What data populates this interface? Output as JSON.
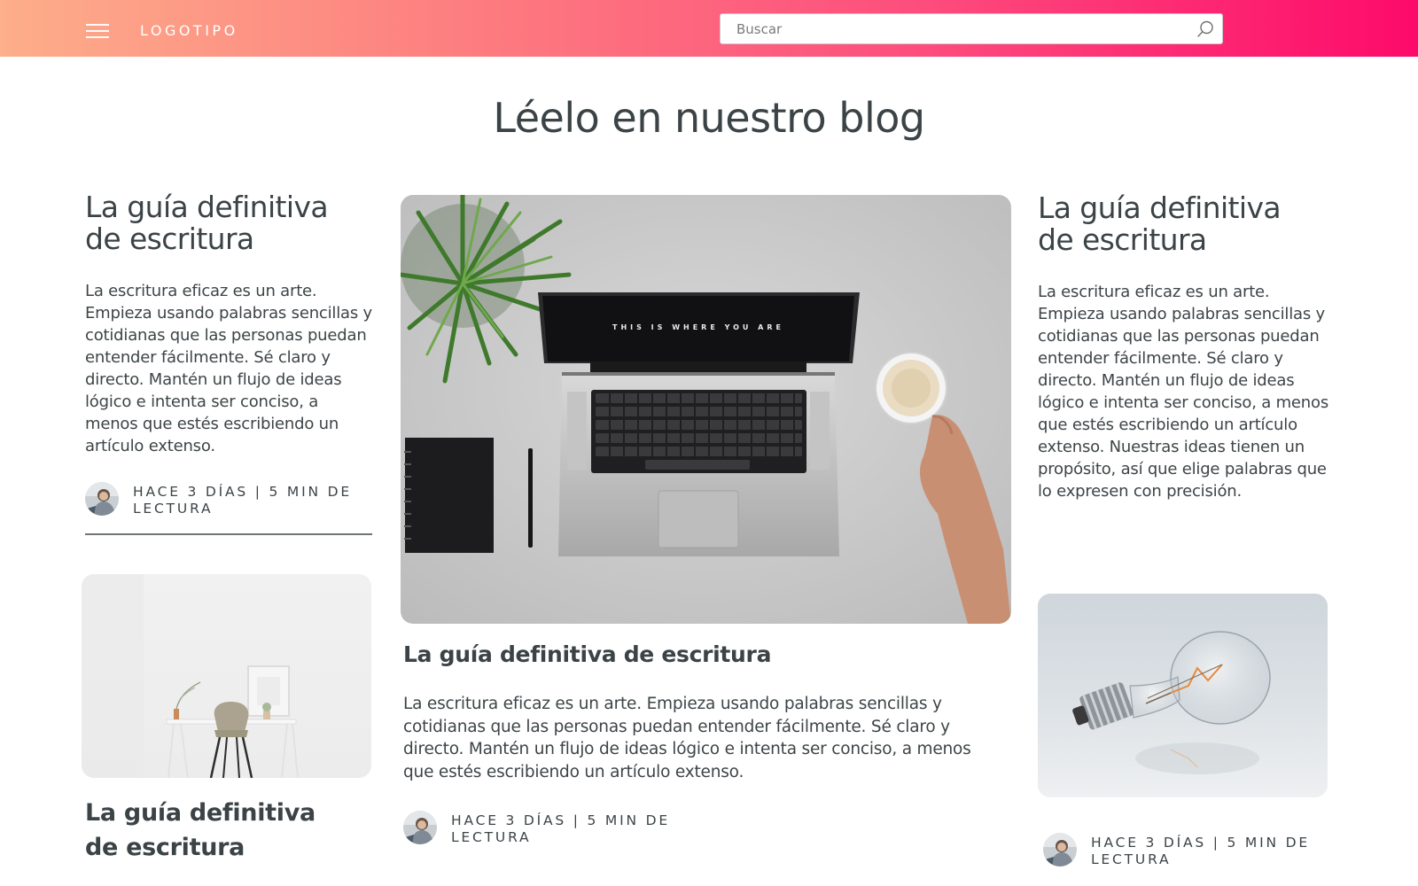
{
  "header": {
    "logo": "LOGOTIPO",
    "search_placeholder": "Buscar",
    "menu_icon": "hamburger-menu-icon",
    "search_icon": "search-icon",
    "gradient": [
      "#fdae8a",
      "#fd7a7f",
      "#fd4d7d",
      "#fd0a6a"
    ]
  },
  "page": {
    "title": "Léelo en nuestro blog"
  },
  "left_column": {
    "post1": {
      "title_line1": "La guía definitiva",
      "title_line2": "de escritura",
      "excerpt": "La escritura eficaz es un arte. Empieza usando palabras sencillas y cotidianas que las personas puedan entender fácilmente. Sé claro y directo. Mantén un flujo de ideas lógico e intenta ser conciso, a menos que estés escribiendo un artículo extenso.",
      "meta": "HACE 3 DÍAS | 5 MIN DE LECTURA"
    },
    "post2": {
      "title": "La guía definitiva de escritura",
      "image": "desk-chair-photo"
    }
  },
  "center_column": {
    "image": "laptop-desk-photo",
    "laptop_screen_text": "THIS IS WHERE YOU ARE",
    "title": "La guía definitiva de escritura",
    "excerpt": "La escritura eficaz es un arte. Empieza usando palabras sencillas y cotidianas que las personas puedan entender fácilmente. Sé claro y directo. Mantén un flujo de ideas lógico e intenta ser conciso, a menos que estés escribiendo un artículo extenso.",
    "meta": "HACE 3 DÍAS | 5 MIN DE LECTURA"
  },
  "right_column": {
    "post1": {
      "title_line1": "La guía definitiva",
      "title_line2": "de escritura",
      "excerpt": "La escritura eficaz es un arte. Empieza usando palabras sencillas y cotidianas que las personas puedan entender fácilmente. Sé claro y directo. Mantén un flujo de ideas lógico e intenta ser conciso, a menos que estés escribiendo un artículo extenso. Nuestras ideas tienen un propósito, así que elige palabras que lo expresen con precisión."
    },
    "post2": {
      "image": "light-bulb-photo",
      "meta": "HACE 3 DÍAS | 5 MIN DE LECTURA"
    }
  }
}
